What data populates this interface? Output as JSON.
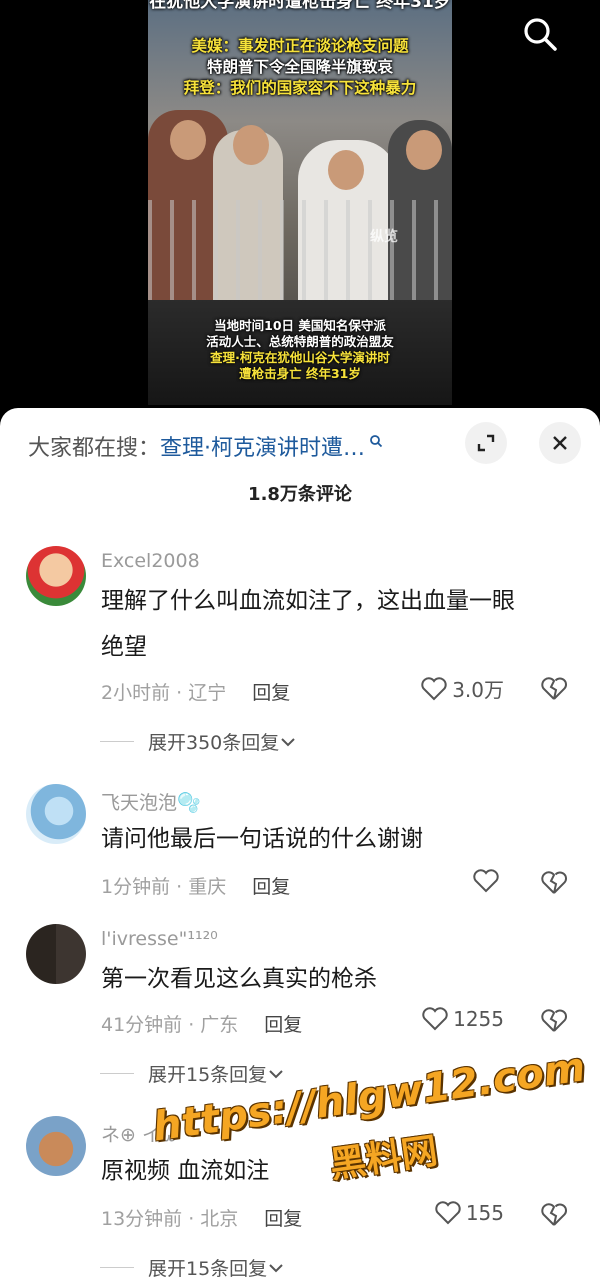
{
  "video": {
    "headline_top": "在犹他大学演讲时遭枪击身亡 终年31岁",
    "headline_lines": [
      "美媒：事发时正在谈论枪支问题",
      "特朗普下令全国降半旗致哀",
      "拜登：我们的国家容不下这种暴力"
    ],
    "source_mark": "纵览",
    "caption_lines": [
      "当地时间10日 美国知名保守派",
      "活动人士、总统特朗普的政治盟友"
    ],
    "caption_highlight_lines": [
      "查理·柯克在犹他山谷大学演讲时",
      "遭枪击身亡 终年31岁"
    ],
    "search_icon": "search-icon"
  },
  "sheet": {
    "search_prefix": "大家都在搜：",
    "search_term": "查理·柯克演讲时遭…",
    "comment_count": "1.8万条评论",
    "expand_icon": "expand-icon",
    "close_icon": "close-icon"
  },
  "comments": [
    {
      "user": "Excel2008",
      "text_lines": [
        "理解了什么叫血流如注了，这出血量一眼",
        "绝望"
      ],
      "time": "2小时前 · 辽宁",
      "reply": "回复",
      "likes": "3.0万",
      "expand": "展开350条回复"
    },
    {
      "user": "飞天泡泡🫧",
      "text_lines": [
        "请问他最后一句话说的什么谢谢"
      ],
      "time": "1分钟前 · 重庆",
      "reply": "回复",
      "likes": "",
      "expand": ""
    },
    {
      "user": "l'ivresse\"¹¹²⁰",
      "text_lines": [
        "第一次看见这么真实的枪杀"
      ],
      "time": "41分钟前 · 广东",
      "reply": "回复",
      "likes": "1255",
      "expand": "展开15条回复"
    },
    {
      "user": "ネ⊕ イω",
      "text_lines": [
        "原视频 血流如注"
      ],
      "time": "13分钟前 · 北京",
      "reply": "回复",
      "likes": "155",
      "expand": "展开15条回复"
    }
  ],
  "watermark": {
    "url": "https://hlgw12.com",
    "name": "黑料网"
  }
}
